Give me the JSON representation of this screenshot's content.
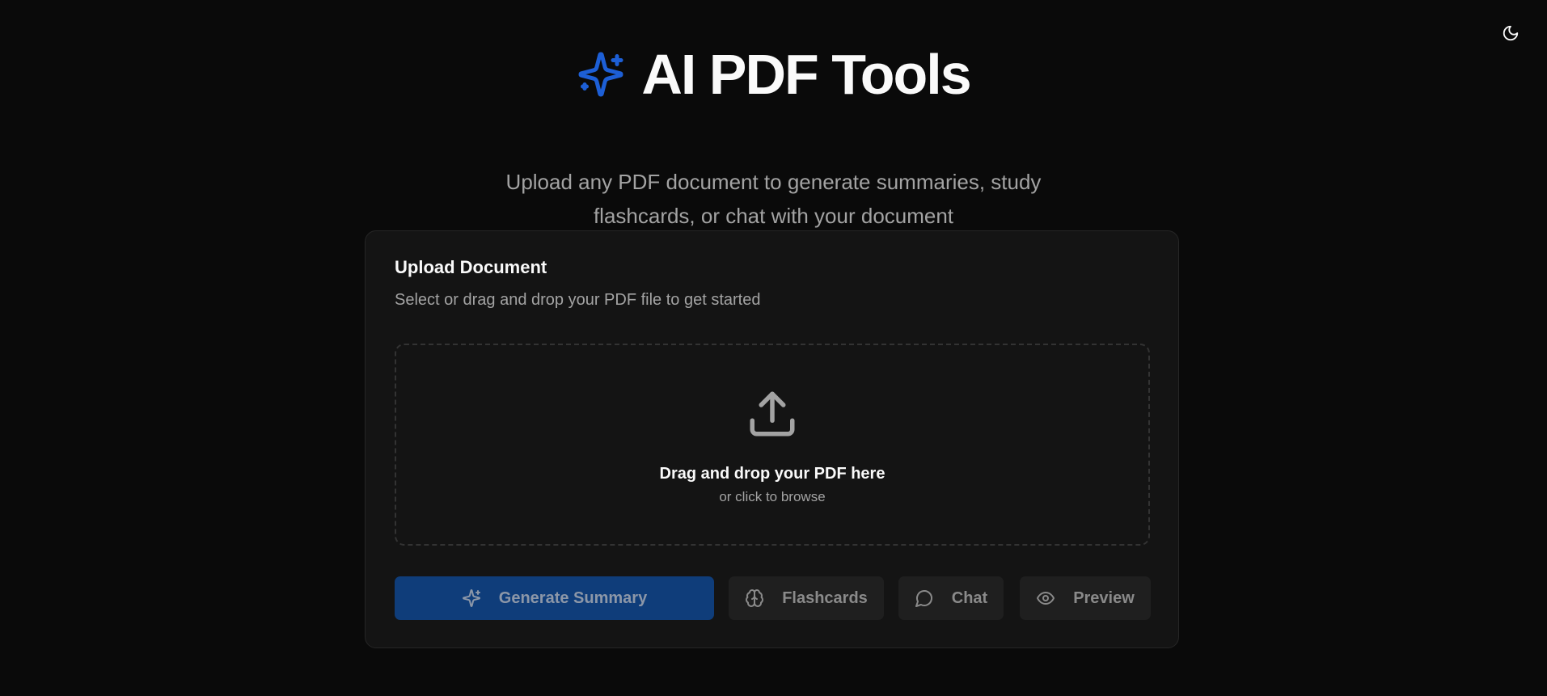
{
  "header": {
    "title": "AI PDF Tools",
    "subtitle": "Upload any PDF document to generate summaries, study flashcards, or chat with your document",
    "theme_toggle_icon": "moon-icon",
    "title_icon": "sparkles-icon",
    "accent_color": "#1d5fd6"
  },
  "upload_card": {
    "title": "Upload Document",
    "description": "Select or drag and drop your PDF file to get started",
    "dropzone": {
      "icon": "upload-icon",
      "main_text": "Drag and drop your PDF here",
      "sub_text": "or click to browse"
    }
  },
  "actions": {
    "generate_summary": {
      "label": "Generate Summary",
      "icon": "sparkles-icon",
      "color": "#0f3d7a"
    },
    "flashcards": {
      "label": "Flashcards",
      "icon": "brain-icon"
    },
    "chat": {
      "label": "Chat",
      "icon": "message-circle-icon"
    },
    "preview": {
      "label": "Preview",
      "icon": "eye-icon"
    }
  }
}
